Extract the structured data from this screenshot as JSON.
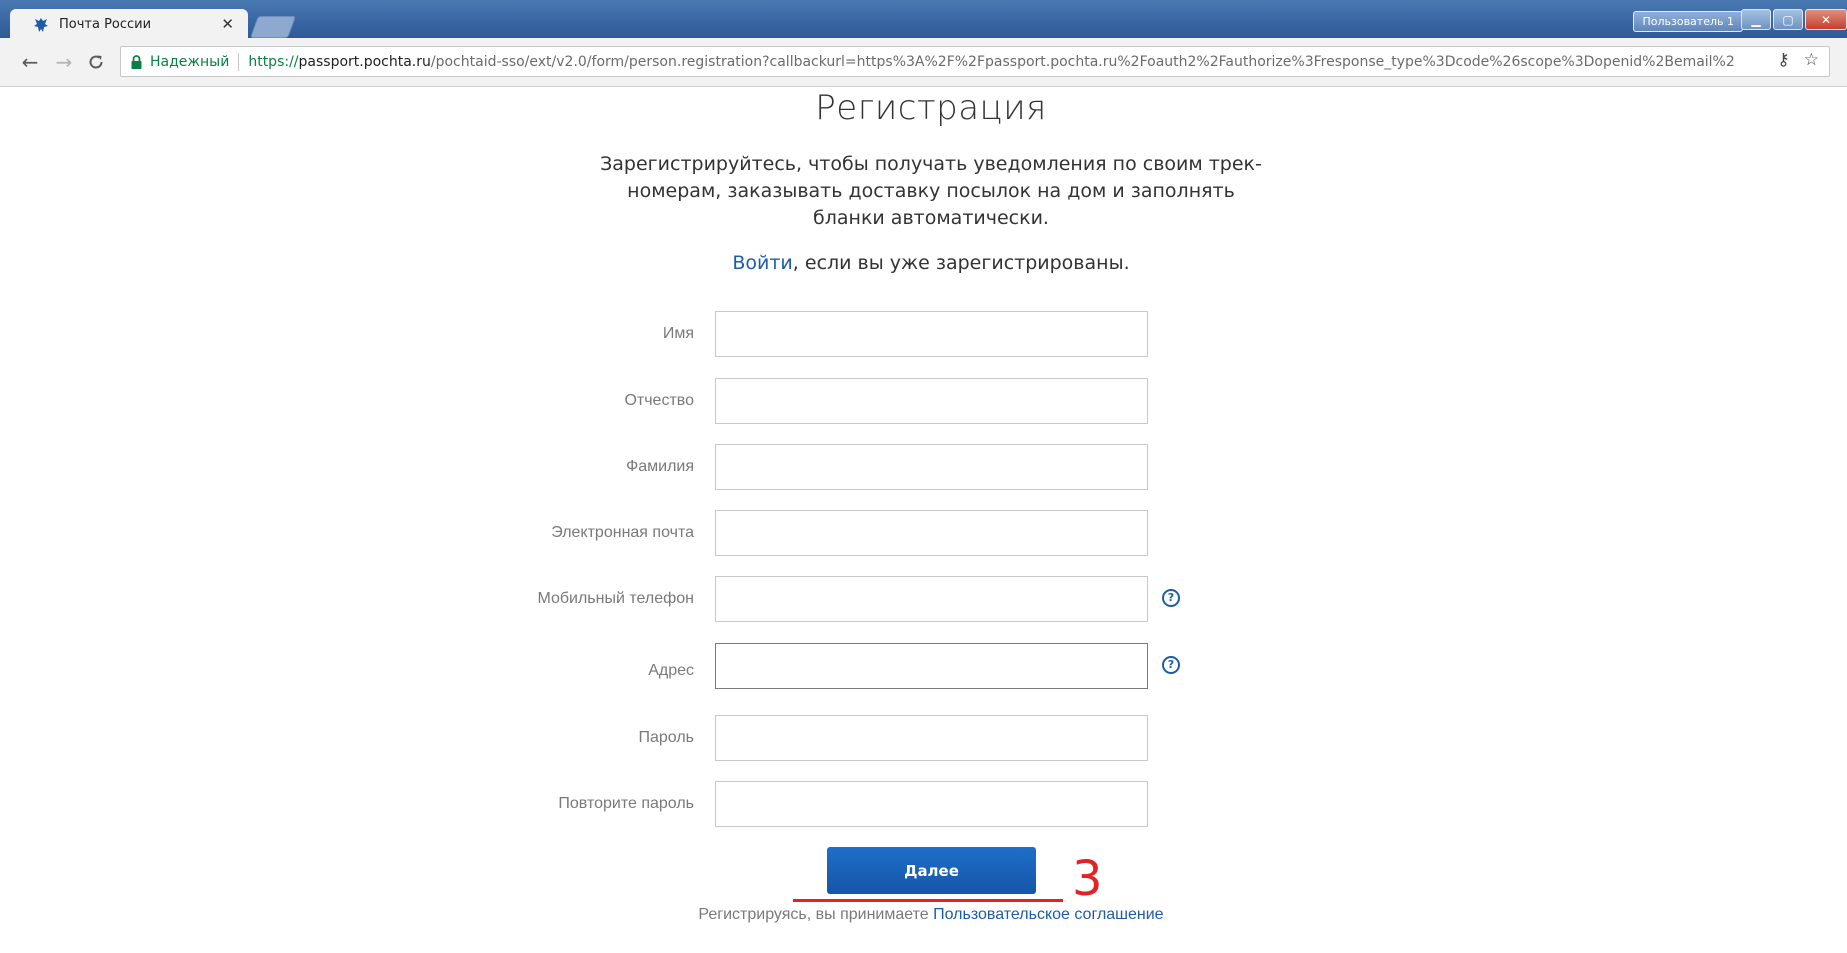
{
  "browser": {
    "tab": {
      "title": "Почта России",
      "close_glyph": "✕",
      "favicon": "russian-post-eagle-icon"
    },
    "profile_label": "Пользователь 1",
    "window_controls": {
      "minimize": "▁",
      "maximize": "▢",
      "close": "✕"
    },
    "nav": {
      "back": "←",
      "forward": "→",
      "reload": "C"
    },
    "address": {
      "secure_label": "Надежный",
      "scheme": "https://",
      "host": "passport.pochta.ru",
      "path": "/pochtaid-sso/ext/v2.0/form/person.registration?callbackurl=https%3A%2F%2Fpassport.pochta.ru%2Foauth2%2Fauthorize%3Fresponse_type%3Dcode%26scope%3Dopenid%2Bemail%2",
      "key_icon_glyph": "⚷",
      "star_icon_glyph": "☆"
    }
  },
  "page": {
    "title": "Регистрация",
    "intro": "Зарегистрируйтесь, чтобы получать уведомления по своим трек-номерам, заказывать доставку посылок на дом и заполнять бланки автоматически.",
    "login": {
      "link_text": "Войти",
      "rest_text": ", если вы уже зарегистрированы."
    },
    "form": {
      "fields": [
        {
          "label": "Имя",
          "value": "",
          "help": false
        },
        {
          "label": "Отчество",
          "value": "",
          "help": false
        },
        {
          "label": "Фамилия",
          "value": "",
          "help": false
        },
        {
          "label": "Электронная почта",
          "value": "",
          "help": false
        },
        {
          "label": "Мобильный телефон",
          "value": "",
          "help": true
        },
        {
          "label": "Адрес",
          "value": "",
          "help": true,
          "focused": true
        },
        {
          "label": "Пароль",
          "value": "",
          "help": false
        },
        {
          "label": "Повторите пароль",
          "value": "",
          "help": false
        }
      ],
      "help_glyph": "?",
      "submit_label": "Далее"
    },
    "agreement": {
      "text": "Регистрируясь, вы принимаете ",
      "link_text": "Пользовательское соглашение"
    },
    "annotation": {
      "number": "3",
      "color": "#e52222"
    }
  },
  "colors": {
    "link": "#1f5ca7",
    "button": "#1656a8",
    "secure": "#0b8043"
  }
}
